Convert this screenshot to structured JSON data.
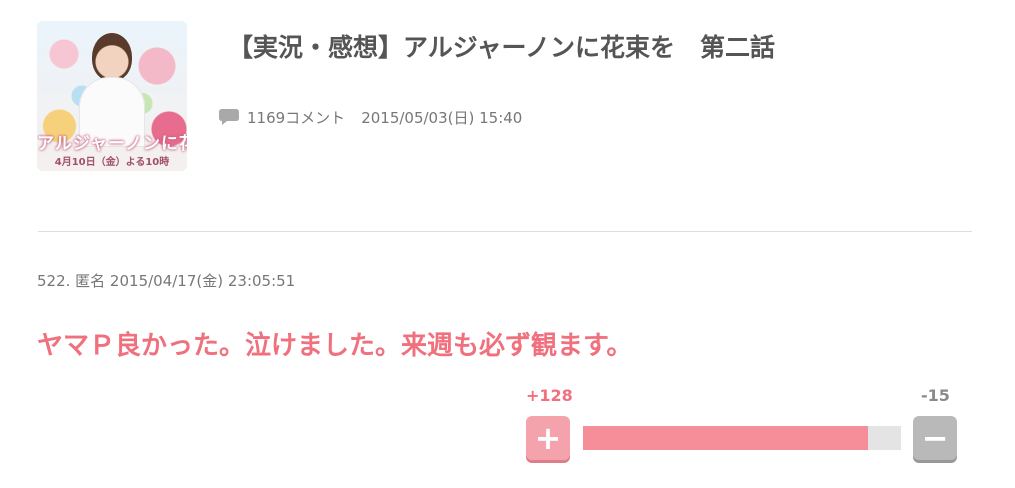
{
  "article": {
    "title": "【実況・感想】アルジャーノンに花束を　第二話",
    "comment_count": "1169コメント",
    "date": "2015/05/03(日) 15:40",
    "thumbnail": {
      "text": "アルジャーノンに花束を",
      "date_text": "4月10日（金）よる10時"
    }
  },
  "comment": {
    "header": "522. 匿名 2015/04/17(金) 23:05:51",
    "body": "ヤマＰ良かった。泣けました。来週も必ず観ます。",
    "votes": {
      "plus_label": "+128",
      "minus_label": "-15",
      "plus": 128,
      "minus": 15,
      "plus_button": "+",
      "minus_button": "−"
    }
  },
  "colors": {
    "accent": "#f0707d",
    "bar_fill": "#f58e99",
    "bar_bg": "#e4e4e4",
    "text_gray": "#777777"
  },
  "icons": {
    "comment": "speech-bubble-icon"
  }
}
